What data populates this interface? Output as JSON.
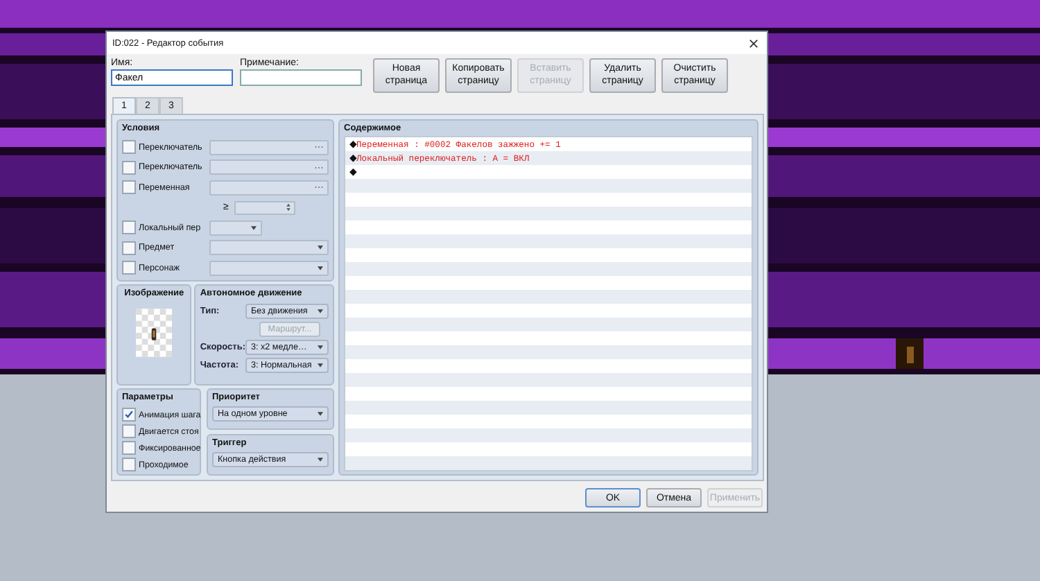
{
  "window": {
    "title": "ID:022 - Редактор события"
  },
  "name_field": {
    "label": "Имя:",
    "value": "Факел"
  },
  "note_field": {
    "label": "Примечание:"
  },
  "page_buttons": [
    {
      "label": "Новая страница",
      "disabled": false
    },
    {
      "label": "Копировать страницу",
      "disabled": false
    },
    {
      "label": "Вставить страницу",
      "disabled": true
    },
    {
      "label": "Удалить страницу",
      "disabled": false
    },
    {
      "label": "Очистить страницу",
      "disabled": false
    }
  ],
  "tabs": [
    {
      "label": "1",
      "selected": true
    },
    {
      "label": "2",
      "selected": false
    },
    {
      "label": "3",
      "selected": false
    }
  ],
  "conditions": {
    "title": "Условия",
    "items": [
      {
        "kind": "picker",
        "label": "Переключатель",
        "checked": false
      },
      {
        "kind": "picker",
        "label": "Переключатель",
        "checked": false
      },
      {
        "kind": "picker",
        "label": "Переменная",
        "checked": false
      },
      {
        "kind": "spin",
        "operator": "≥"
      },
      {
        "kind": "small-select",
        "label": "Локальный пер",
        "checked": false
      },
      {
        "kind": "select",
        "label": "Предмет",
        "checked": false
      },
      {
        "kind": "select",
        "label": "Персонаж",
        "checked": false
      }
    ]
  },
  "image": {
    "title": "Изображение"
  },
  "movement": {
    "title": "Автономное движение",
    "type_label": "Тип:",
    "type_value": "Без движения",
    "route_button": {
      "label": "Маршрут...",
      "disabled": true
    },
    "speed_label": "Скорость:",
    "speed_value": "3: x2 медле…",
    "frequency_label": "Частота:",
    "frequency_value": "3: Нормальная"
  },
  "options": {
    "title": "Параметры",
    "items": [
      {
        "label": "Анимация шага",
        "checked": true
      },
      {
        "label": "Двигается стоя",
        "checked": false
      },
      {
        "label": "Фиксированное",
        "checked": false
      },
      {
        "label": "Проходимое",
        "checked": false
      }
    ]
  },
  "priority": {
    "title": "Приоритет",
    "value": "На одном уровне"
  },
  "trigger": {
    "title": "Триггер",
    "value": "Кнопка действия"
  },
  "contents": {
    "title": "Содержимое",
    "lines": [
      {
        "marker": "◆",
        "text": "Переменная : #0002 Факелов зажжено += 1"
      },
      {
        "marker": "◆",
        "text": "Локальный переключатель : A = ВКЛ"
      },
      {
        "marker": "◆"
      }
    ]
  },
  "footer_buttons": [
    {
      "label": "OK",
      "disabled": false
    },
    {
      "label": "Отмена",
      "disabled": false
    },
    {
      "label": "Применить",
      "disabled": true
    }
  ]
}
